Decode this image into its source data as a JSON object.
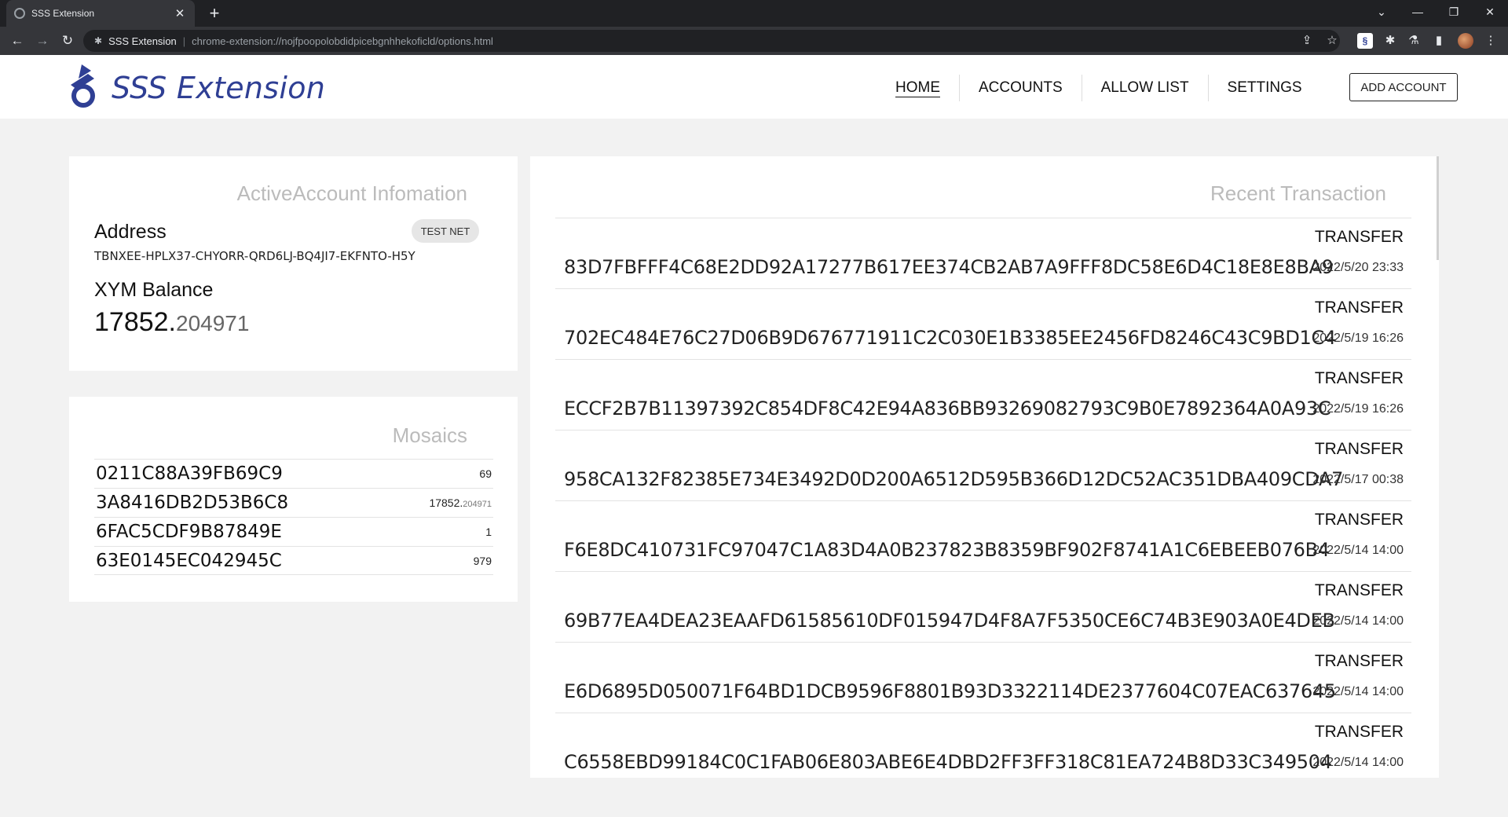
{
  "browser": {
    "tab_title": "SSS Extension",
    "tab_close": "✕",
    "new_tab": "+",
    "site_name": "SSS Extension",
    "url": "chrome-extension://nojfpoopolobdidpicebgnhhekoficld/options.html"
  },
  "app": {
    "brand": "SSS Extension",
    "nav": [
      "HOME",
      "ACCOUNTS",
      "ALLOW LIST",
      "SETTINGS"
    ],
    "add_account": "ADD ACCOUNT"
  },
  "account": {
    "title": "ActiveAccount Infomation",
    "address_label": "Address",
    "network_badge": "TEST NET",
    "address": "TBNXEE-HPLX37-CHYORR-QRD6LJ-BQ4JI7-EKFNTO-H5Y",
    "balance_label": "XYM Balance",
    "balance_int": "17852.",
    "balance_frac": "204971"
  },
  "mosaics": {
    "title": "Mosaics",
    "items": [
      {
        "id": "0211C88A39FB69C9",
        "amount_int": "69",
        "amount_frac": ""
      },
      {
        "id": "3A8416DB2D53B6C8",
        "amount_int": "17852.",
        "amount_frac": "204971"
      },
      {
        "id": "6FAC5CDF9B87849E",
        "amount_int": "1",
        "amount_frac": ""
      },
      {
        "id": "63E0145EC042945C",
        "amount_int": "979",
        "amount_frac": ""
      }
    ]
  },
  "transactions": {
    "title": "Recent Transaction",
    "items": [
      {
        "type": "TRANSFER",
        "hash": "83D7FBFFF4C68E2DD92A17277B617EE374CB2AB7A9FFF8DC58E6D4C18E8E8BA9",
        "date": "2022/5/20 23:33"
      },
      {
        "type": "TRANSFER",
        "hash": "702EC484E76C27D06B9D676771911C2C030E1B3385EE2456FD8246C43C9BD1C4",
        "date": "2022/5/19 16:26"
      },
      {
        "type": "TRANSFER",
        "hash": "ECCF2B7B11397392C854DF8C42E94A836BB93269082793C9B0E7892364A0A93C",
        "date": "2022/5/19 16:26"
      },
      {
        "type": "TRANSFER",
        "hash": "958CA132F82385E734E3492D0D200A6512D595B366D12DC52AC351DBA409CDA7",
        "date": "2022/5/17 00:38"
      },
      {
        "type": "TRANSFER",
        "hash": "F6E8DC410731FC97047C1A83D4A0B237823B8359BF902F8741A1C6EBEEB076B4",
        "date": "2022/5/14 14:00"
      },
      {
        "type": "TRANSFER",
        "hash": "69B77EA4DEA23EAAFD61585610DF015947D4F8A7F5350CE6C74B3E903A0E4DEB",
        "date": "2022/5/14 14:00"
      },
      {
        "type": "TRANSFER",
        "hash": "E6D6895D050071F64BD1DCB9596F8801B93D3322114DE2377604C07EAC637645",
        "date": "2022/5/14 14:00"
      },
      {
        "type": "TRANSFER",
        "hash": "C6558EBD99184C0C1FAB06E803ABE6E4DBD2FF3FF318C81EA724B8D33C349504",
        "date": "2022/5/14 14:00"
      }
    ]
  }
}
